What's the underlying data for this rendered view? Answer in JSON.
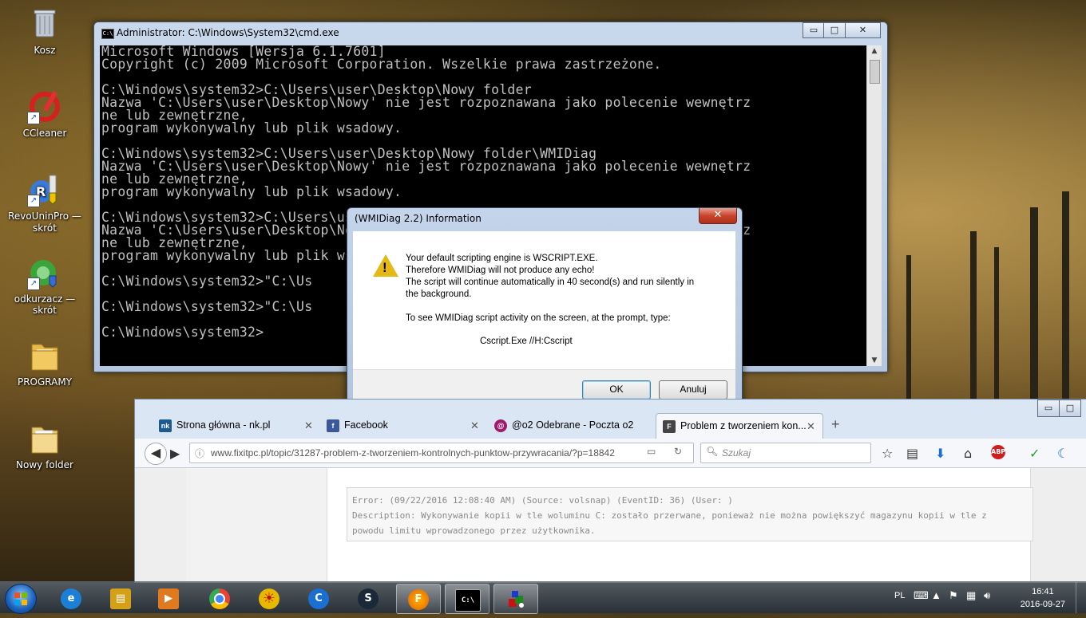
{
  "desktop": {
    "icons": [
      {
        "label": "Kosz",
        "icon": "recycle-bin-icon"
      },
      {
        "label": "CCleaner",
        "icon": "ccleaner-icon"
      },
      {
        "label": "RevoUninPro — skrót",
        "icon": "revo-uninstaller-icon"
      },
      {
        "label": "odkurzacz — skrót",
        "icon": "vacuum-shortcut-icon"
      },
      {
        "label": "PROGRAMY",
        "icon": "folder-icon"
      },
      {
        "label": "Nowy folder",
        "icon": "folder-icon"
      }
    ]
  },
  "cmd": {
    "title": "Administrator: C:\\Windows\\System32\\cmd.exe",
    "icon_text": "C:\\",
    "minimize": "▭",
    "maximize": "□",
    "close": "✕",
    "output": "Microsoft Windows [Wersja 6.1.7601]\nCopyright (c) 2009 Microsoft Corporation. Wszelkie prawa zastrzeżone.\n\nC:\\Windows\\system32>C:\\Users\\user\\Desktop\\Nowy folder\nNazwa 'C:\\Users\\user\\Desktop\\Nowy' nie jest rozpoznawana jako polecenie wewnętrz\nne lub zewnętrzne,\nprogram wykonywalny lub plik wsadowy.\n\nC:\\Windows\\system32>C:\\Users\\user\\Desktop\\Nowy folder\\WMIDiag\nNazwa 'C:\\Users\\user\\Desktop\\Nowy' nie jest rozpoznawana jako polecenie wewnętrz\nne lub zewnętrzne,\nprogram wykonywalny lub plik wsadowy.\n\nC:\\Windows\\system32>C:\\Users\\user\\Desktop\\Nowy folder\\WMIDiag\nNazwa 'C:\\Users\\user\\Desktop\\Nowy' nie jest rozpoznawana jako polecenie wewnętrz\nne lub zewnętrzne,\nprogram wykonywalny lub plik wsadowy.\n\nC:\\Windows\\system32>\"C:\\Us\n\nC:\\Windows\\system32>\"C:\\Us\n\nC:\\Windows\\system32>"
  },
  "dialog": {
    "title": "(WMIDiag 2.2) Information",
    "close": "✕",
    "message_lines": [
      "Your default scripting engine is WSCRIPT.EXE.",
      "Therefore WMIDiag will not produce any echo!",
      "The script will continue automatically in 40 second(s) and run silently in",
      "the background.",
      "",
      "To see WMIDiag script activity on the screen, at the prompt, type:"
    ],
    "command": "Cscript.Exe //H:Cscript",
    "ok_label": "OK",
    "cancel_label": "Anuluj"
  },
  "firefox": {
    "tabs": [
      {
        "label": "Strona główna - nk.pl",
        "favicon": "nk",
        "color": "#1d5a8f",
        "active": false
      },
      {
        "label": "Facebook",
        "favicon": "f",
        "color": "#3b5998",
        "active": false
      },
      {
        "label": "@o2 Odebrane - Poczta o2",
        "favicon": "@",
        "color": "#a01a6b",
        "active": false
      },
      {
        "label": "Problem z tworzeniem kon...",
        "favicon": "F",
        "color": "#444444",
        "active": true
      }
    ],
    "new_tab": "+",
    "url": "www.fixitpc.pl/topic/31287-problem-z-tworzeniem-kontrolnych-punktow-przywracania/?p=18842",
    "search_placeholder": "Szukaj",
    "error_lines": [
      "Error: (09/22/2016 12:08:40 AM) (Source: volsnap) (EventID: 36) (User: )",
      "Description: Wykonywanie kopii w tle woluminu C: zostało przerwane, ponieważ nie można powiększyć magazynu kopii w tle z",
      "powodu limitu wprowadzonego przez użytkownika."
    ],
    "minimize": "▭",
    "maximize": "□"
  },
  "taskbar": {
    "items": [
      {
        "icon": "internet-explorer-icon",
        "glyph": "e",
        "color": "#1c7fd6"
      },
      {
        "icon": "file-explorer-icon",
        "glyph": "▤",
        "color": "#d4a017"
      },
      {
        "icon": "media-player-icon",
        "glyph": "▶",
        "color": "#e07a20"
      },
      {
        "icon": "chrome-icon",
        "glyph": "●",
        "color": "#34a853"
      },
      {
        "icon": "sun-app-icon",
        "glyph": "☀",
        "color": "#e8b800"
      },
      {
        "icon": "ccleaner-task-icon",
        "glyph": "C",
        "color": "#1a6fd0"
      },
      {
        "icon": "steam-icon",
        "glyph": "S",
        "color": "#1b2838"
      },
      {
        "icon": "firefox-icon",
        "glyph": "F",
        "color": "#e66000"
      },
      {
        "icon": "cmd-icon",
        "glyph": "C:\\",
        "color": "#000000"
      },
      {
        "icon": "wmidiag-icon",
        "glyph": "■",
        "color": "#d01010"
      }
    ],
    "language": "PL",
    "time": "16:41",
    "date": "2016-09-27"
  }
}
